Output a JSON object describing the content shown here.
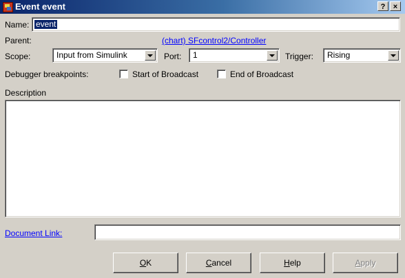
{
  "window": {
    "title": "Event event",
    "help_button": "?",
    "close_button": "×"
  },
  "name": {
    "label": "Name:",
    "value": "event"
  },
  "parent": {
    "label": "Parent:",
    "link_text": "(chart) SFcontrol2/Controller"
  },
  "scope": {
    "label": "Scope:",
    "selected": "Input from Simulink"
  },
  "port": {
    "label": "Port:",
    "selected": "1"
  },
  "trigger": {
    "label": "Trigger:",
    "selected": "Rising"
  },
  "breakpoints": {
    "label": "Debugger breakpoints:",
    "start_label": "Start of Broadcast",
    "end_label": "End of Broadcast"
  },
  "description": {
    "label": "Description",
    "value": ""
  },
  "document_link": {
    "label": "Document Link:",
    "value": ""
  },
  "buttons": {
    "ok_mnemonic": "O",
    "ok_rest": "K",
    "cancel_mnemonic": "C",
    "cancel_rest": "ancel",
    "help_mnemonic": "H",
    "help_rest": "elp",
    "apply_mnemonic": "A",
    "apply_rest": "pply"
  }
}
